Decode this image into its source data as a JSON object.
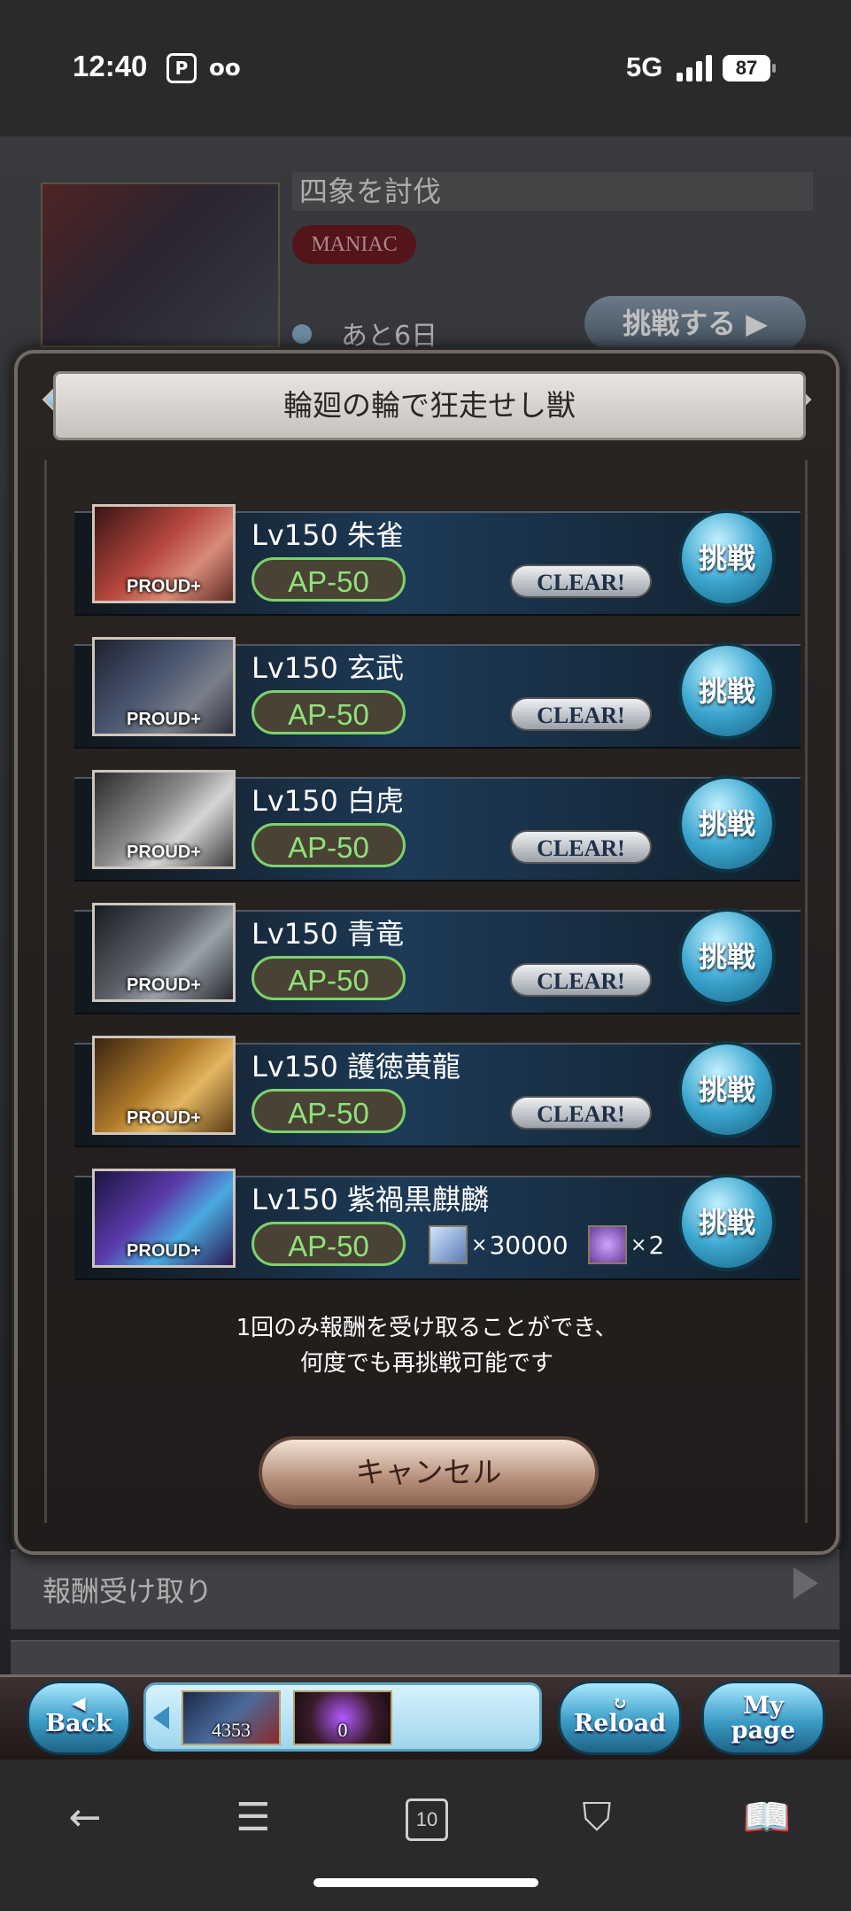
{
  "status_bar": {
    "time": "12:40",
    "network": "5G",
    "battery": "87"
  },
  "background": {
    "event_title": "四象を討伐",
    "difficulty_badge": "MANIAC",
    "remaining": "あと6日",
    "challenge_button": "挑戦する ▶",
    "rows": [
      "報酬受け取り"
    ]
  },
  "modal": {
    "title": "輪廻の輪で狂走せし獣",
    "quests": [
      {
        "name": "Lv150 朱雀",
        "ap": "AP-50",
        "badge": "PROUD+",
        "status": "CLEAR!",
        "button": "挑戦"
      },
      {
        "name": "Lv150 玄武",
        "ap": "AP-50",
        "badge": "PROUD+",
        "status": "CLEAR!",
        "button": "挑戦"
      },
      {
        "name": "Lv150 白虎",
        "ap": "AP-50",
        "badge": "PROUD+",
        "status": "CLEAR!",
        "button": "挑戦"
      },
      {
        "name": "Lv150 青竜",
        "ap": "AP-50",
        "badge": "PROUD+",
        "status": "CLEAR!",
        "button": "挑戦"
      },
      {
        "name": "Lv150 護徳黄龍",
        "ap": "AP-50",
        "badge": "PROUD+",
        "status": "CLEAR!",
        "button": "挑戦"
      },
      {
        "name": "Lv150 紫禍黒麒麟",
        "ap": "AP-50",
        "badge": "PROUD+",
        "button": "挑戦",
        "rewards": [
          {
            "qty": "30000"
          },
          {
            "qty": "2"
          }
        ]
      }
    ],
    "note_line1": "1回のみ報酬を受け取ることができ、",
    "note_line2": "何度でも再挑戦可能です",
    "cancel": "キャンセル"
  },
  "game_nav": {
    "back_top": "◀",
    "back": "Back",
    "reload_top": "↻",
    "reload": "Reload",
    "mypage_top": "My",
    "mypage": "page",
    "item1_count": "4353",
    "item2_count": "0"
  },
  "browser": {
    "tab_count": "10"
  },
  "colors": {
    "ap_green": "#7bd36b",
    "challenge_blue": "#3ba6cf",
    "maniac_red": "#6f1b23"
  }
}
